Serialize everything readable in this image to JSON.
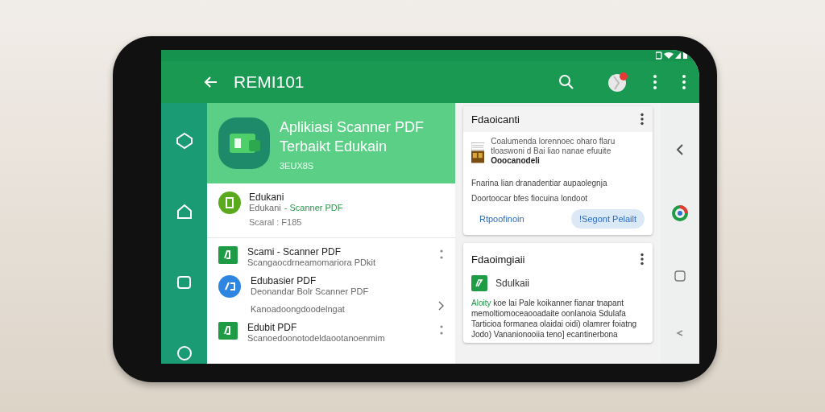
{
  "app_bar": {
    "title": "REMI101"
  },
  "hero": {
    "title_lines": [
      "Aplikiasi Scanner PDF",
      "Terbaikt Edukain"
    ],
    "subtitle": "3EUX8S"
  },
  "featured": {
    "name": "Edukani",
    "subtitle": "Edukani",
    "accent": "- Scanner PDF",
    "meta": "Scaral : F185"
  },
  "list": [
    {
      "icon": {
        "kind": "square"
      },
      "title": "Scami - Scanner PDF",
      "subtitle": "Scangaocdrneamomariora PDkit",
      "action": {
        "kind": "more"
      }
    },
    {
      "icon": {
        "kind": "circle"
      },
      "title": "Edubasier PDF",
      "subtitle": "Deonandar Bolr Scanner PDF",
      "extra": "Kanoadoongdoodelngat",
      "action": {
        "kind": "chevron"
      }
    },
    {
      "icon": {
        "kind": "square"
      },
      "title": "Edubit PDF",
      "subtitle": "Scanoedoonotodeldaootanoenmim",
      "action": {
        "kind": "more"
      }
    }
  ],
  "card_1": {
    "title": "Fdaoicanti",
    "description": "Coalumenda lorennoec oharo flaru tloaswoni d Bai liao nanae efuuite",
    "bold_line": "Ooocanodeli",
    "body": [
      "Fnarina lian dranadentiar aupaolegnja",
      "Doortoocar bfes fiocuina londoot"
    ],
    "buttons": [
      {
        "label": "Rtpoofinoin",
        "kind": "text"
      },
      {
        "label": "!Segont Pelailt",
        "kind": "tonal"
      }
    ]
  },
  "card_2": {
    "title": "Fdaoimgiaii",
    "app_name": "Sdulkaii",
    "accent": "Aloity",
    "description": "koe lai Pale koikanner fianar tnapant memoltiomoceaooadaite oonlanoia Sdulafa Tarticioa formanea olaidai oidi) olamrer foiatng Jodo) Vananionooiia teno] ecantinerbona"
  }
}
